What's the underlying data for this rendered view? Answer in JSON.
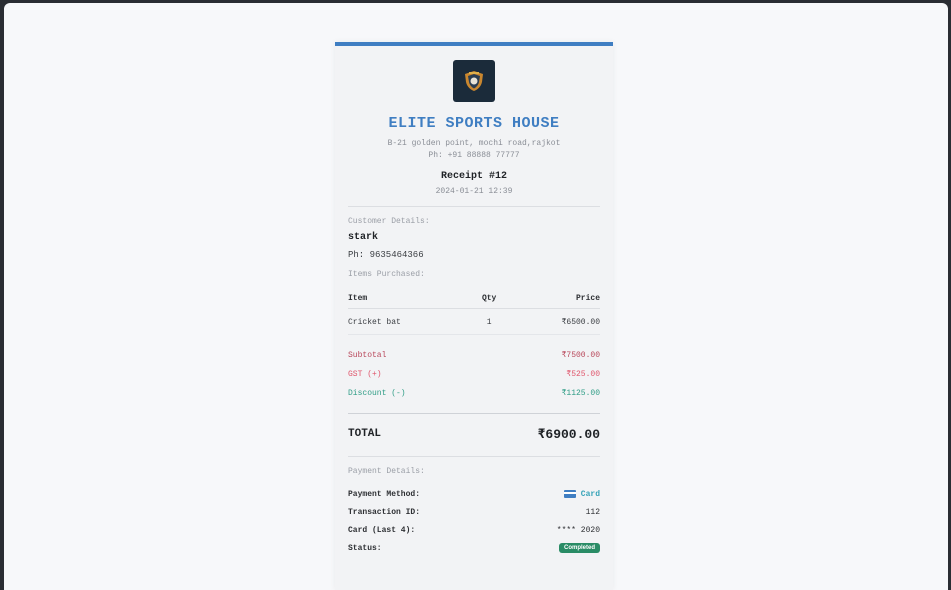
{
  "shop": {
    "name": "ELITE SPORTS HOUSE",
    "address": "B-21 golden point, mochi road,rajkot",
    "phone": "Ph: +91 88888 77777"
  },
  "receipt": {
    "title": "Receipt #12",
    "datetime": "2024-01-21 12:39"
  },
  "customer": {
    "section_label": "Customer Details:",
    "name": "stark",
    "phone": "Ph: 9635464366"
  },
  "items_section": {
    "label": "Items Purchased:",
    "headers": [
      "Item",
      "Qty",
      "Price"
    ],
    "rows": [
      {
        "item": "Cricket bat",
        "qty": "1",
        "price": "₹6500.00"
      }
    ]
  },
  "summary": {
    "subtotal_label": "Subtotal",
    "subtotal_value": "₹7500.00",
    "gst_label": "GST (+)",
    "gst_value": "₹525.00",
    "discount_label": "Discount (-)",
    "discount_value": "₹1125.00",
    "total_label": "TOTAL",
    "total_value": "₹6900.00"
  },
  "payment": {
    "section_label": "Payment Details:",
    "method_label": "Payment Method:",
    "method_value": "Card",
    "transaction_label": "Transaction ID:",
    "transaction_value": "112",
    "card_label": "Card (Last 4):",
    "card_value": "**** 2020",
    "status_label": "Status:",
    "status_value": "Completed"
  },
  "colors": {
    "accent": "#3f7ec2",
    "gst": "#e0566c",
    "discount": "#2f9d86",
    "status": "#2a8c66"
  },
  "icons": {
    "logo": "sports-shield-logo-icon",
    "payment_method": "credit-card-icon"
  }
}
